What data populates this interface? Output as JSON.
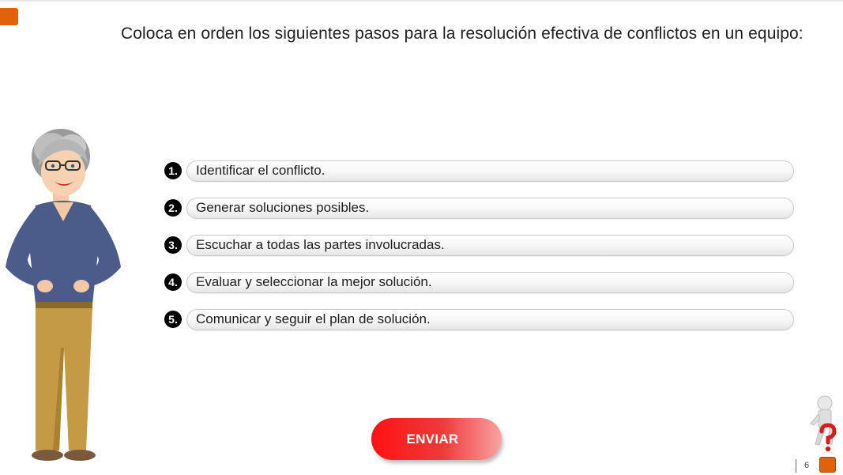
{
  "question": "Coloca en orden los siguientes pasos para la resolución efectiva de conflictos en un equipo:",
  "steps": [
    {
      "number": "1.",
      "text": "Identificar el conflicto."
    },
    {
      "number": "2.",
      "text": "Generar soluciones posibles."
    },
    {
      "number": "3.",
      "text": "Escuchar a todas las partes involucradas."
    },
    {
      "number": "4.",
      "text": "Evaluar y seleccionar la mejor solución."
    },
    {
      "number": "5.",
      "text": "Comunicar y seguir el plan de solución."
    }
  ],
  "submit_label": "ENVIAR",
  "page_number": "6",
  "colors": {
    "accent": "#e0620d",
    "button": "#ff1212",
    "number_badge": "#000000"
  },
  "icons": {
    "help": "help-question-figure-icon",
    "next": "next-page-icon"
  }
}
